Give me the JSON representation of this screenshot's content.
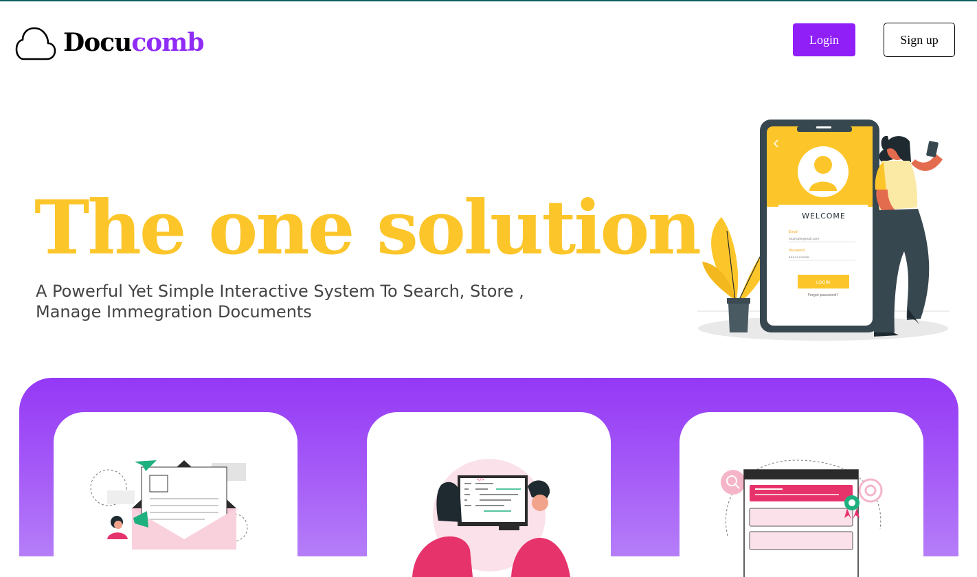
{
  "brand": {
    "part1": "Docu",
    "part2": "comb",
    "logo_icon": "cloud-icon"
  },
  "header": {
    "login_label": "Login",
    "signup_label": "Sign up"
  },
  "hero": {
    "title": "The one solution",
    "subtitle_line1": "A Powerful Yet Simple Interactive System To Search, Store ,",
    "subtitle_line2": "Manage Immegration Documents"
  },
  "phone_mock": {
    "welcome": "WELCOME",
    "email_label": "Email",
    "email_value": "example@mail.com",
    "password_label": "Password",
    "login_button": "LOGIN",
    "forgot": "Forgot password?"
  },
  "colors": {
    "brand_purple": "#8f2cf5",
    "login_button": "#8f1ef7",
    "hero_yellow": "#fcc62b",
    "panel_purple": "#9438f6"
  }
}
